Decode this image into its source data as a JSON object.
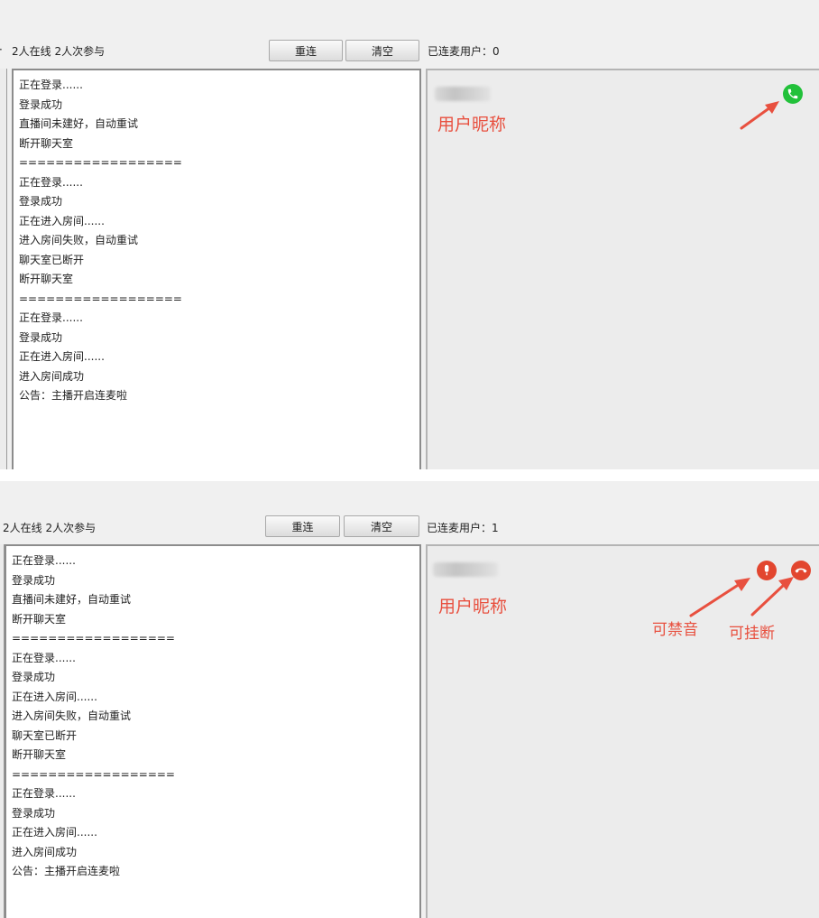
{
  "top_panel": {
    "status_text": "2人在线 2人次参与",
    "reconnect_label": "重连",
    "clear_label": "清空",
    "connected_users": "已连麦用户：0",
    "log_lines": [
      "正在登录......",
      "登录成功",
      "直播间未建好，自动重试",
      "断开聊天室",
      "==================",
      "正在登录......",
      "登录成功",
      "正在进入房间......",
      "进入房间失败，自动重试",
      "聊天室已断开",
      "断开聊天室",
      "==================",
      "正在登录......",
      "登录成功",
      "正在进入房间......",
      "进入房间成功",
      "公告：主播开启连麦啦"
    ],
    "user_nickname": "用户昵称",
    "call_icon": "phone-icon",
    "call_icon_color": "#22c13a"
  },
  "bottom_panel": {
    "status_text": "2人在线 2人次参与",
    "reconnect_label": "重连",
    "clear_label": "清空",
    "connected_users": "已连麦用户：1",
    "log_lines": [
      "正在登录......",
      "登录成功",
      "直播间未建好，自动重试",
      "断开聊天室",
      "==================",
      "正在登录......",
      "登录成功",
      "正在进入房间......",
      "进入房间失败，自动重试",
      "聊天室已断开",
      "断开聊天室",
      "==================",
      "正在登录......",
      "登录成功",
      "正在进入房间......",
      "进入房间成功",
      "公告：主播开启连麦啦"
    ],
    "user_nickname": "用户昵称",
    "mute_icon": "microphone-icon",
    "hangup_icon": "hang-up-icon",
    "mute_annotation": "可禁音",
    "hangup_annotation": "可挂断",
    "icon_color": "#e2462f"
  },
  "colors": {
    "annotation": "#e8503f",
    "background": "#f0f0f0"
  }
}
